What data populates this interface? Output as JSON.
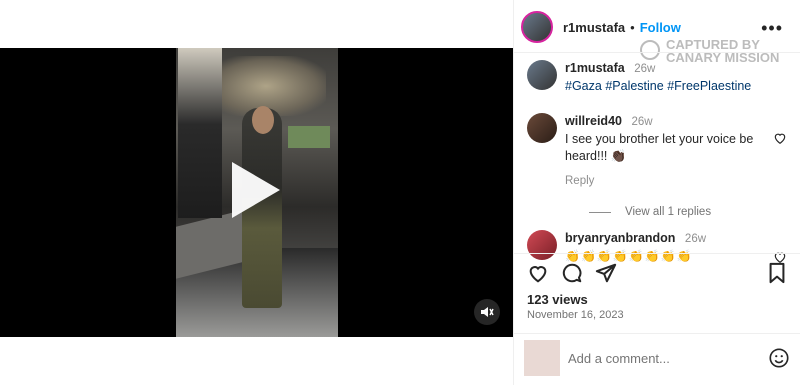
{
  "post": {
    "username": "r1mustafa",
    "follow_label": "Follow",
    "separator": "•",
    "more_label": "•••"
  },
  "watermark": {
    "line1": "CAPTURED BY",
    "line2": "CANARY MISSION"
  },
  "caption": {
    "username": "r1mustafa",
    "age": "26w",
    "hashtags": [
      "#Gaza",
      "#Palestine",
      "#FreePlaestine"
    ]
  },
  "comments": [
    {
      "username": "willreid40",
      "age": "26w",
      "text": "I see you brother let your voice be heard!!! 👏🏿",
      "reply_label": "Reply"
    },
    {
      "username": "bryanryanbrandon",
      "age": "26w",
      "text": "👏👏👏👏👏👏👏👏"
    }
  ],
  "view_replies": "View all 1 replies",
  "stats": {
    "views": "123 views",
    "date": "November 16, 2023"
  },
  "add_comment": {
    "placeholder": "Add a comment..."
  },
  "icons": [
    "heart-icon",
    "comment-icon",
    "share-icon",
    "bookmark-icon",
    "emoji-icon",
    "play-icon",
    "mute-icon",
    "more-icon"
  ],
  "colors": {
    "link": "#0095f6",
    "hashtag": "#00376b",
    "muted": "#737373"
  }
}
